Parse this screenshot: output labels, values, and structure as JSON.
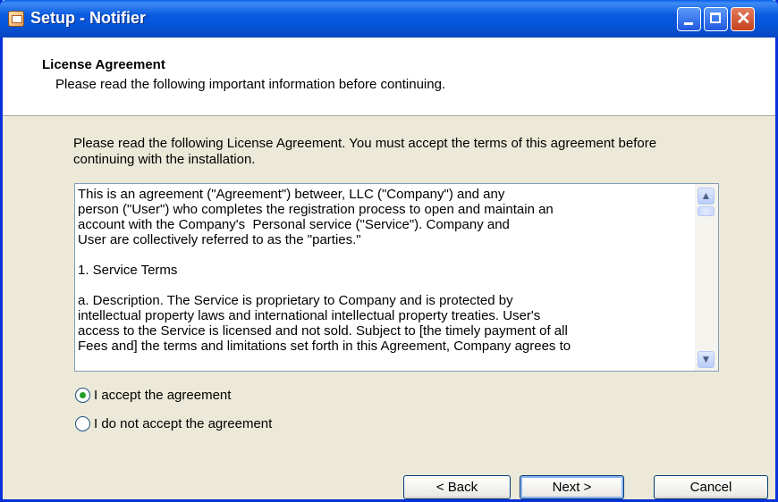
{
  "window": {
    "title": "Setup - Notifier",
    "controls": {
      "minimize": "minimize",
      "maximize": "maximize",
      "close": "close"
    }
  },
  "header": {
    "title": "License Agreement",
    "subtitle": "Please read the following important information before continuing."
  },
  "instructions": "Please read the following License Agreement. You must accept the terms of this agreement before continuing with the installation.",
  "license_text": "This is an agreement (\"Agreement\") betweer, LLC (\"Company\") and any\nperson (\"User\") who completes the registration process to open and maintain an\naccount with the Company's  Personal service (\"Service\"). Company and\nUser are collectively referred to as the \"parties.\"\n\n1. Service Terms\n\na. Description. The Service is proprietary to Company and is protected by\nintellectual property laws and international intellectual property treaties. User's\naccess to the Service is licensed and not sold. Subject to [the timely payment of all\nFees and] the terms and limitations set forth in this Agreement, Company agrees to",
  "options": {
    "accept": {
      "label": "I accept the agreement",
      "selected": true
    },
    "decline": {
      "label": "I do not accept the agreement",
      "selected": false
    }
  },
  "buttons": {
    "back": "< Back",
    "next": "Next >",
    "cancel": "Cancel"
  },
  "icons": {
    "app": "setup-icon",
    "scroll_up": "arrow-up-icon",
    "scroll_down": "arrow-down-icon"
  },
  "colors": {
    "titlebar": "#0A5AE0",
    "dialog_bg": "#ECE9D8",
    "radio_dot": "#21A121"
  }
}
